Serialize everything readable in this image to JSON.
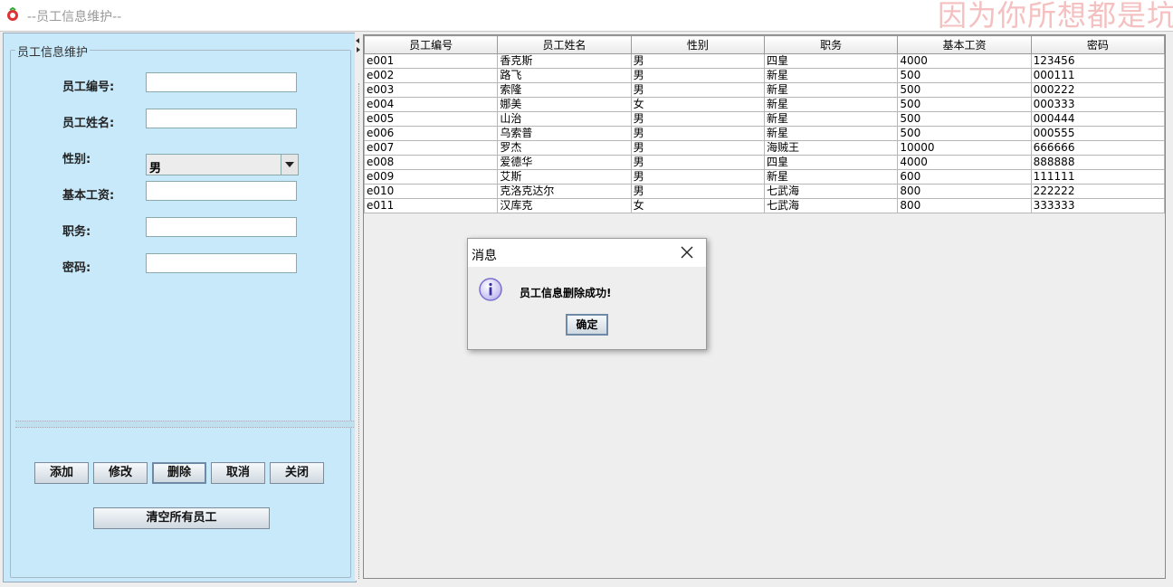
{
  "window": {
    "title": "--员工信息维护--"
  },
  "watermark": "因为你所想都是坑",
  "form": {
    "group_title": "员工信息维护",
    "fields": [
      {
        "label": "员工编号:",
        "value": ""
      },
      {
        "label": "员工姓名:",
        "value": ""
      },
      {
        "label": "性别:",
        "value": "男"
      },
      {
        "label": "基本工资:",
        "value": ""
      },
      {
        "label": "职务:",
        "value": ""
      },
      {
        "label": "密码:",
        "value": ""
      }
    ],
    "buttons": {
      "add": "添加",
      "modify": "修改",
      "delete": "删除",
      "cancel": "取消",
      "close": "关闭",
      "clear_all": "清空所有员工"
    }
  },
  "table": {
    "headers": [
      "员工编号",
      "员工姓名",
      "性别",
      "职务",
      "基本工资",
      "密码"
    ],
    "rows": [
      [
        "e001",
        "香克斯",
        "男",
        "四皇",
        "4000",
        "123456"
      ],
      [
        "e002",
        "路飞",
        "男",
        "新星",
        "500",
        "000111"
      ],
      [
        "e003",
        "索隆",
        "男",
        "新星",
        "500",
        "000222"
      ],
      [
        "e004",
        "娜美",
        "女",
        "新星",
        "500",
        "000333"
      ],
      [
        "e005",
        "山治",
        "男",
        "新星",
        "500",
        "000444"
      ],
      [
        "e006",
        "乌索普",
        "男",
        "新星",
        "500",
        "000555"
      ],
      [
        "e007",
        "罗杰",
        "男",
        "海贼王",
        "10000",
        "666666"
      ],
      [
        "e008",
        "爱德华",
        "男",
        "四皇",
        "4000",
        "888888"
      ],
      [
        "e009",
        "艾斯",
        "男",
        "新星",
        "600",
        "111111"
      ],
      [
        "e010",
        "克洛克达尔",
        "男",
        "七武海",
        "800",
        "222222"
      ],
      [
        "e011",
        "汉库克",
        "女",
        "七武海",
        "800",
        "333333"
      ]
    ]
  },
  "dialog": {
    "title": "消息",
    "message": "员工信息删除成功!",
    "ok": "确定"
  },
  "colors": {
    "panel_bg": "#c8e9fa",
    "frame_bg": "#eeeeee",
    "watermark": "#f4c0c0",
    "info_icon": "#7b6fd0"
  },
  "icons": {
    "app": "app-icon",
    "info": "info-icon",
    "close": "close-icon",
    "dropdown": "chevron-down-icon"
  }
}
